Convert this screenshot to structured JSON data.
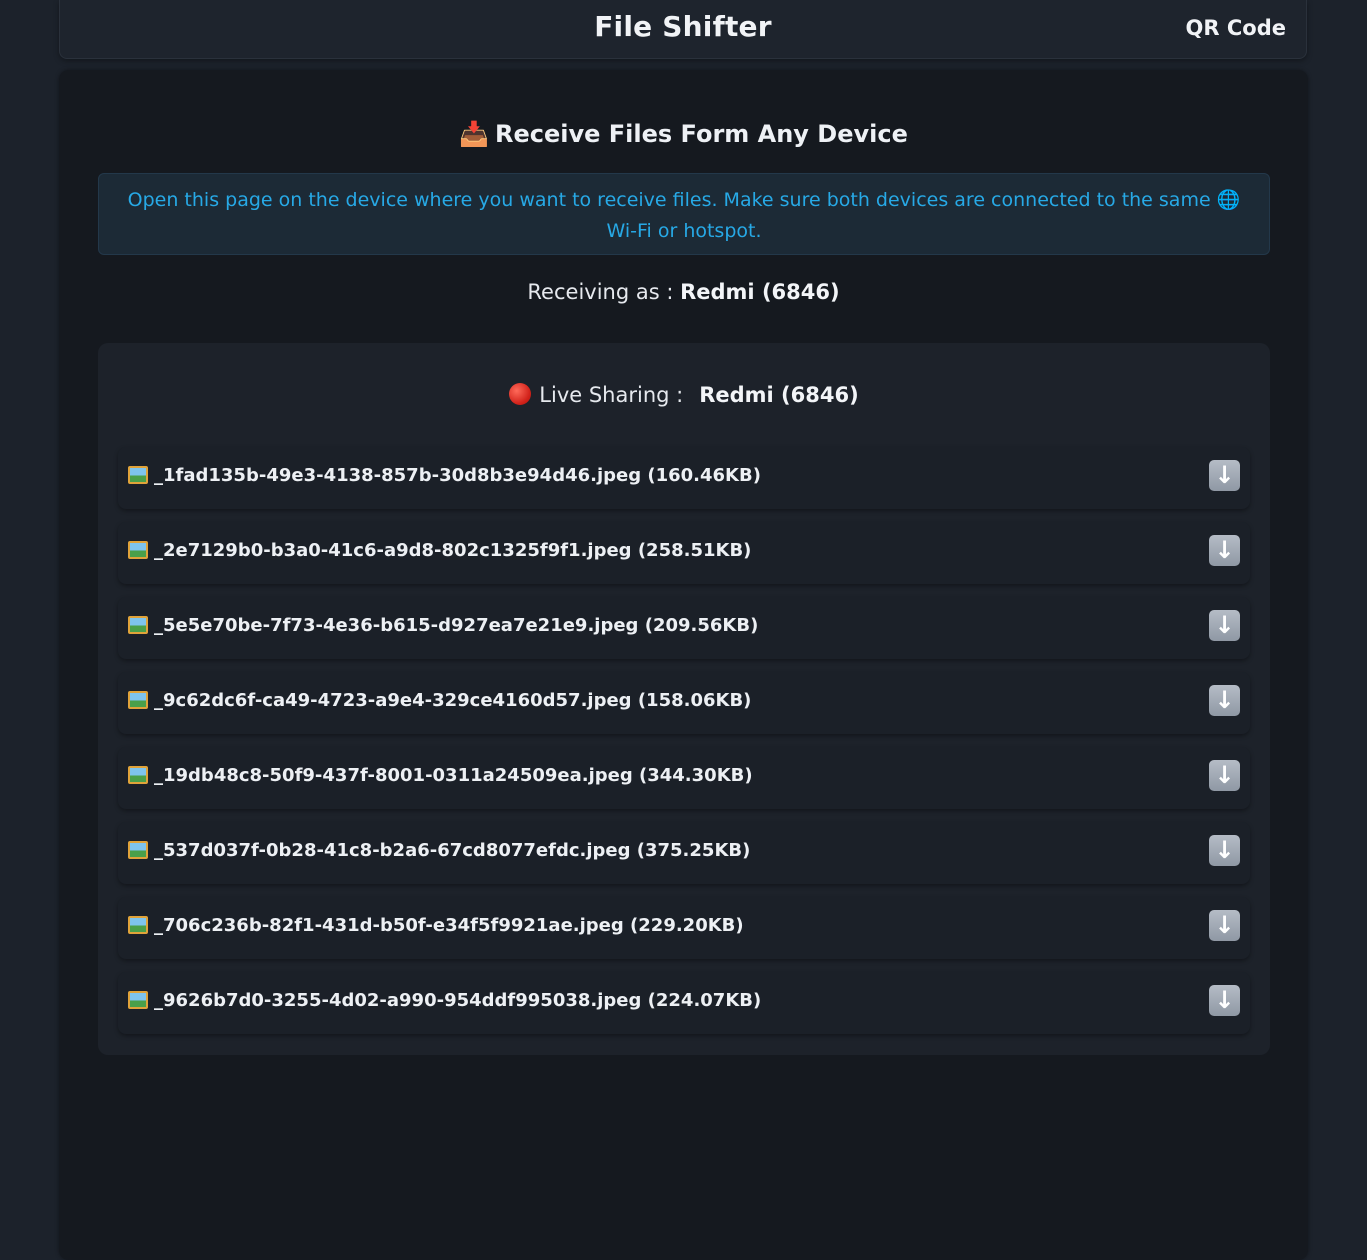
{
  "header": {
    "app_title": "File Shifter",
    "qr_label": "QR Code"
  },
  "receive": {
    "title_emoji": "📥",
    "title": "Receive Files Form Any Device",
    "info_text": "Open this page on the device where you want to receive files. Make sure both devices are connected to the same 🌐 Wi-Fi or hotspot.",
    "receiving_label": "Receiving as :",
    "receiving_name": "Redmi (6846)"
  },
  "live": {
    "label": "Live Sharing :",
    "device_name": "Redmi (6846)",
    "status_color": "#d2221a"
  },
  "files": [
    {
      "name": "_1fad135b-49e3-4138-857b-30d8b3e94d46.jpeg (160.46KB)",
      "icon": "image-file-icon",
      "action_icon": "download-arrow-icon"
    },
    {
      "name": "_2e7129b0-b3a0-41c6-a9d8-802c1325f9f1.jpeg (258.51KB)",
      "icon": "image-file-icon",
      "action_icon": "download-arrow-icon"
    },
    {
      "name": "_5e5e70be-7f73-4e36-b615-d927ea7e21e9.jpeg (209.56KB)",
      "icon": "image-file-icon",
      "action_icon": "download-arrow-icon"
    },
    {
      "name": "_9c62dc6f-ca49-4723-a9e4-329ce4160d57.jpeg (158.06KB)",
      "icon": "image-file-icon",
      "action_icon": "download-arrow-icon"
    },
    {
      "name": "_19db48c8-50f9-437f-8001-0311a24509ea.jpeg (344.30KB)",
      "icon": "image-file-icon",
      "action_icon": "download-arrow-icon"
    },
    {
      "name": "_537d037f-0b28-41c8-b2a6-67cd8077efdc.jpeg (375.25KB)",
      "icon": "image-file-icon",
      "action_icon": "download-arrow-icon"
    },
    {
      "name": "_706c236b-82f1-431d-b50f-e34f5f9921ae.jpeg (229.20KB)",
      "icon": "image-file-icon",
      "action_icon": "download-arrow-icon"
    },
    {
      "name": "_9626b7d0-3255-4d02-a990-954ddf995038.jpeg (224.07KB)",
      "icon": "image-file-icon",
      "action_icon": "download-arrow-icon"
    }
  ],
  "colors": {
    "info_text": "#27a9e6",
    "page_bg": "#15191f",
    "panel_bg": "#1d222a"
  }
}
